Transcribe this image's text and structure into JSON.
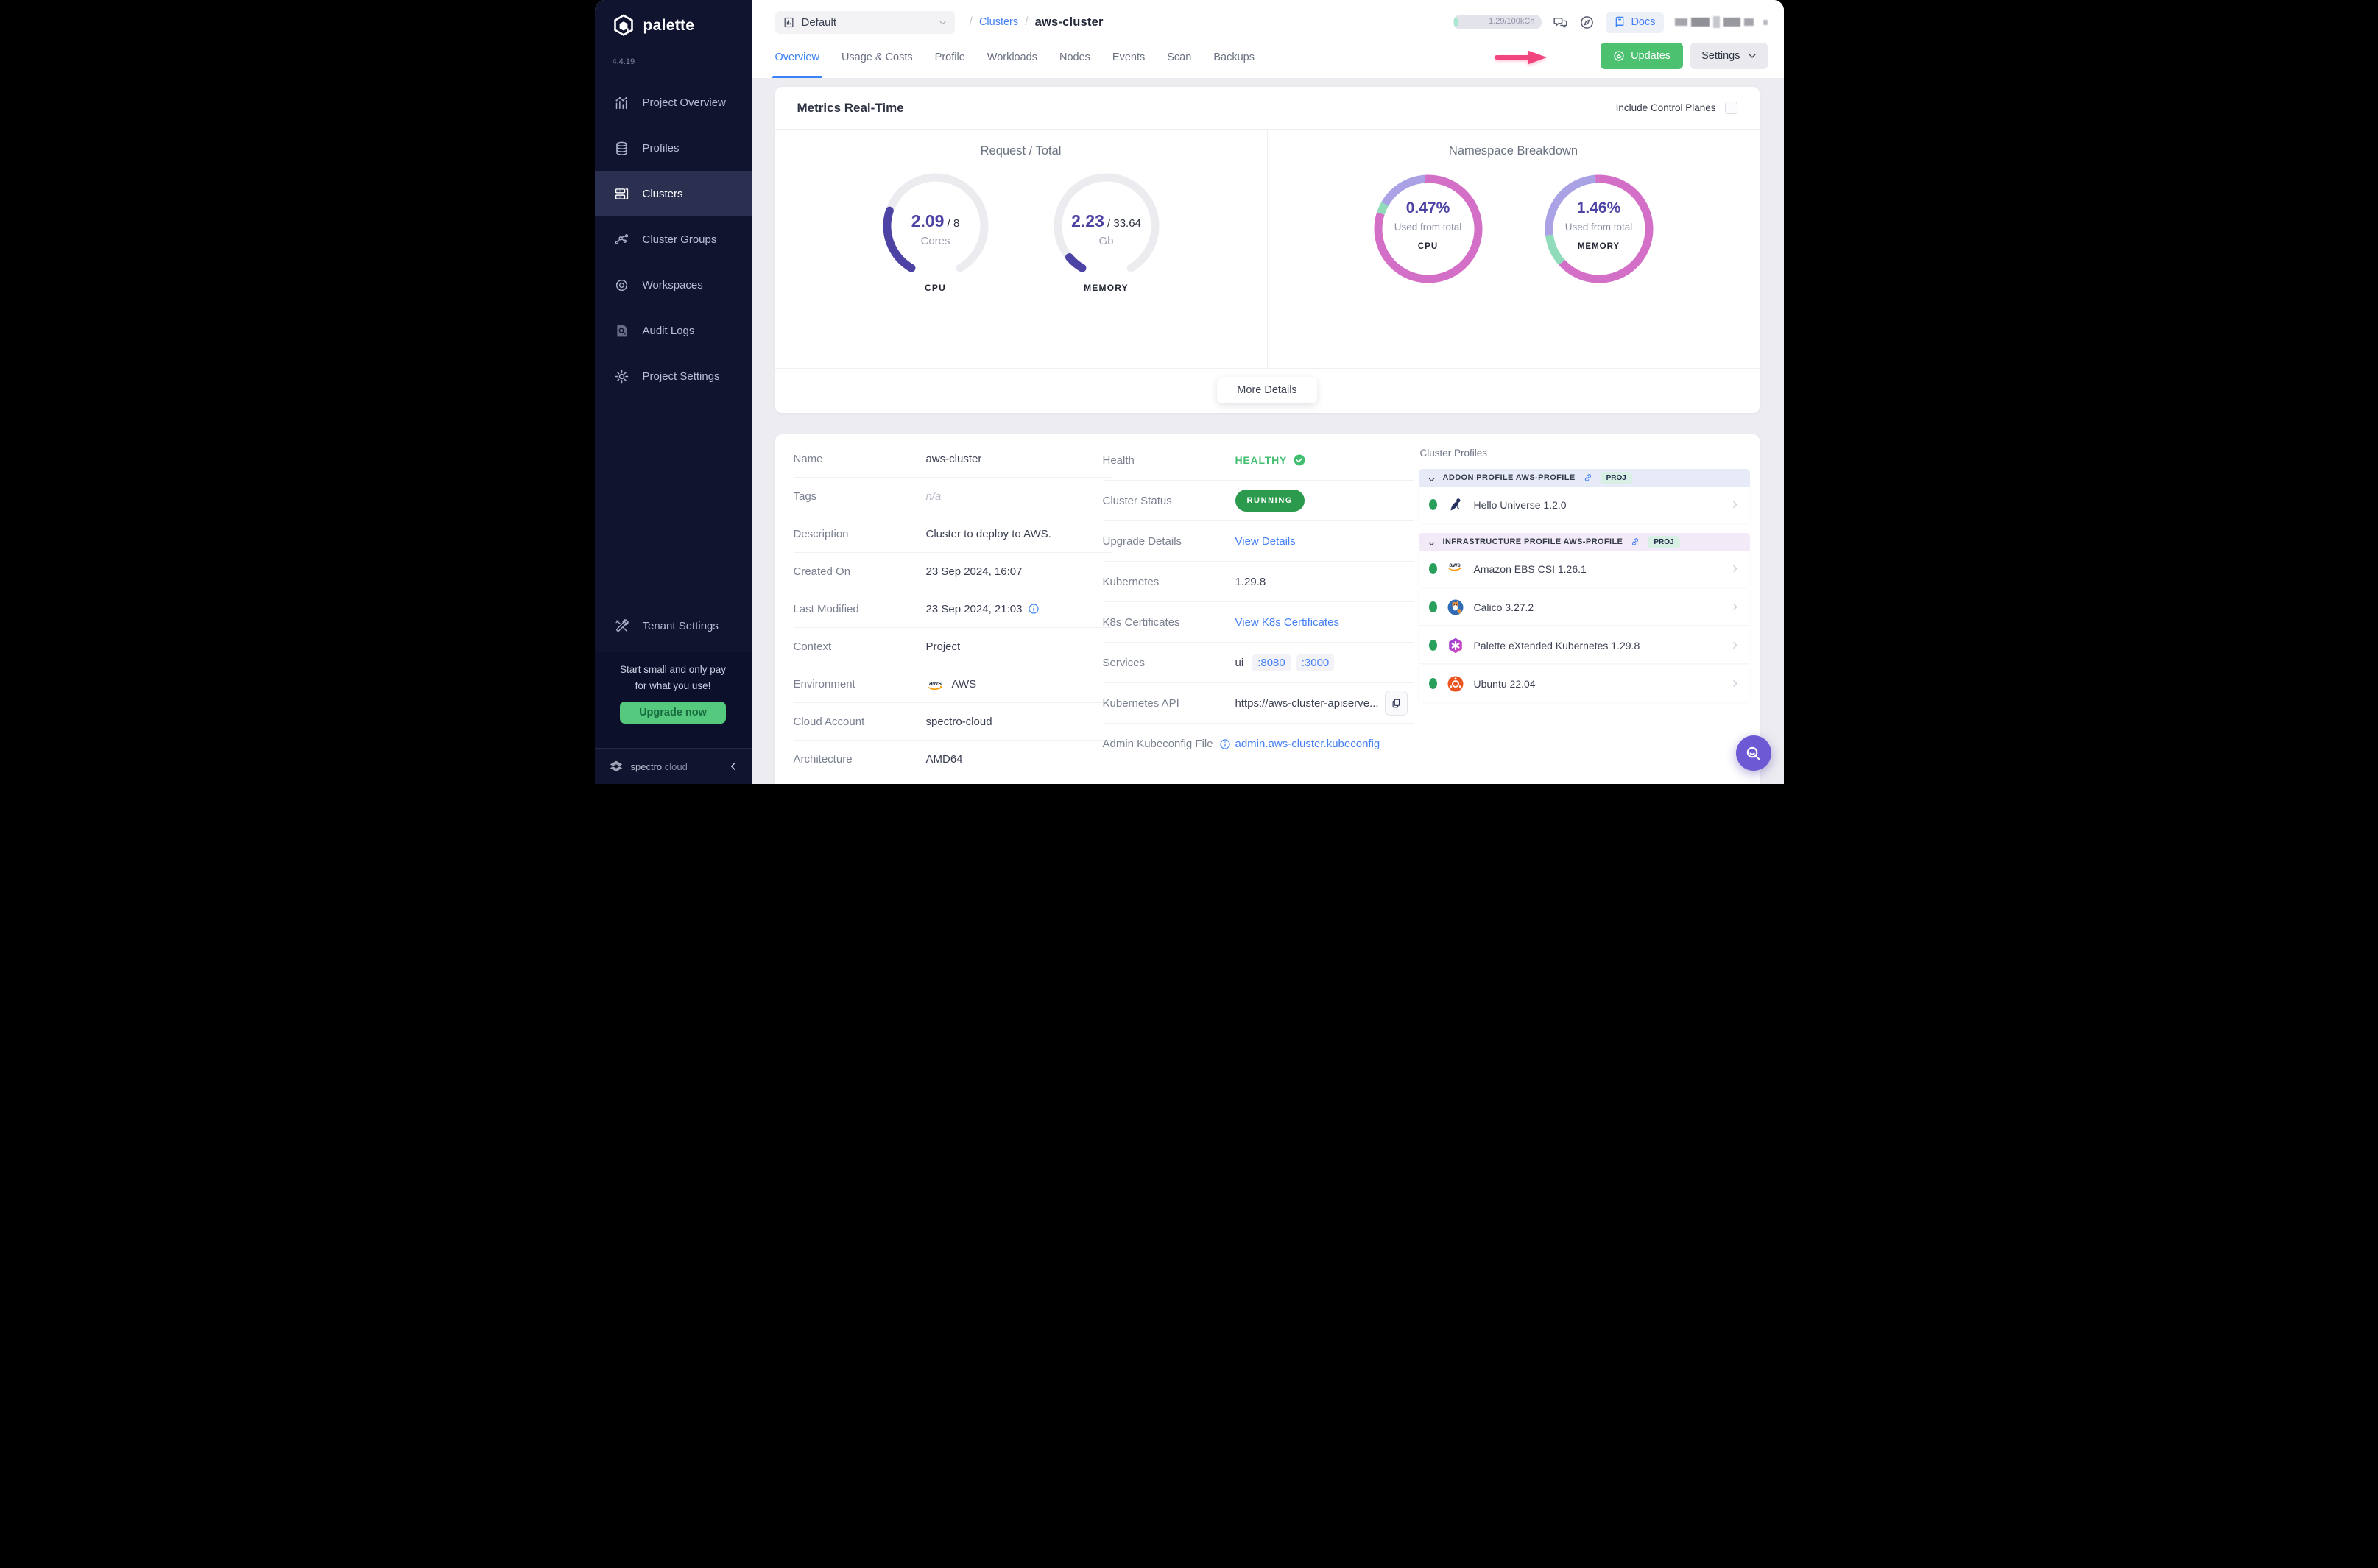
{
  "app": {
    "brand": "palette",
    "version": "4.4.19",
    "footer_brand_1": "spectro",
    "footer_brand_2": "cloud"
  },
  "sidebar": {
    "items": [
      {
        "icon": "overview-icon",
        "label": "Project Overview",
        "active": false
      },
      {
        "icon": "profiles-icon",
        "label": "Profiles",
        "active": false
      },
      {
        "icon": "clusters-icon",
        "label": "Clusters",
        "active": true
      },
      {
        "icon": "cluster-groups-icon",
        "label": "Cluster Groups",
        "active": false
      },
      {
        "icon": "workspaces-icon",
        "label": "Workspaces",
        "active": false
      },
      {
        "icon": "audit-icon",
        "label": "Audit Logs",
        "active": false
      },
      {
        "icon": "gear-icon",
        "label": "Project Settings",
        "active": false
      }
    ],
    "tenant": {
      "icon": "tools-icon",
      "label": "Tenant Settings"
    },
    "promo": {
      "line1": "Start small and only pay",
      "line2": "for what you use!",
      "cta": "Upgrade now"
    }
  },
  "topbar": {
    "project_selector": "Default",
    "breadcrumb": {
      "root_sep": "/",
      "section": "Clusters",
      "sep": "/",
      "current": "aws-cluster"
    },
    "usage_pill": "1.29/100kCh",
    "docs_label": "Docs"
  },
  "tabs": {
    "active": "Overview",
    "items": [
      "Overview",
      "Usage & Costs",
      "Profile",
      "Workloads",
      "Nodes",
      "Events",
      "Scan",
      "Backups"
    ]
  },
  "actions": {
    "updates": "Updates",
    "settings": "Settings"
  },
  "metrics": {
    "title": "Metrics Real-Time",
    "include_control_planes": "Include Control Planes",
    "include_checked": false,
    "left_title": "Request / Total",
    "right_title": "Namespace Breakdown",
    "more_details": "More Details"
  },
  "chart_data": [
    {
      "type": "gauge",
      "group": "Request / Total",
      "label": "CPU",
      "value": 2.09,
      "total": 8,
      "unit": "Cores",
      "color": "#4C43A4",
      "track": "#ECECF0"
    },
    {
      "type": "gauge",
      "group": "Request / Total",
      "label": "MEMORY",
      "value": 2.23,
      "total": 33.64,
      "unit": "Gb",
      "color": "#4C43A4",
      "track": "#ECECF0"
    },
    {
      "type": "donut",
      "group": "Namespace Breakdown",
      "label": "CPU",
      "center_value": "0.47%",
      "center_caption": "Used from total",
      "segments": [
        {
          "color": "#D36FC6",
          "from": 0,
          "to": 288
        },
        {
          "color": "#90DBB9",
          "from": 288,
          "to": 300
        },
        {
          "color": "#A9A2E5",
          "from": 300,
          "to": 356
        },
        {
          "color": "#D36FC6",
          "from": 356,
          "to": 360
        }
      ]
    },
    {
      "type": "donut",
      "group": "Namespace Breakdown",
      "label": "MEMORY",
      "center_value": "1.46%",
      "center_caption": "Used from total",
      "segments": [
        {
          "color": "#D36FC6",
          "from": 0,
          "to": 228
        },
        {
          "color": "#90DBB9",
          "from": 228,
          "to": 263
        },
        {
          "color": "#A9A2E5",
          "from": 263,
          "to": 356
        },
        {
          "color": "#D36FC6",
          "from": 356,
          "to": 360
        }
      ]
    }
  ],
  "details": {
    "left": [
      {
        "label": "Name",
        "value": "aws-cluster",
        "type": "text"
      },
      {
        "label": "Tags",
        "value": "n/a",
        "type": "muted"
      },
      {
        "label": "Description",
        "value": "Cluster to deploy to AWS.",
        "type": "text"
      },
      {
        "label": "Created On",
        "value": "23 Sep 2024, 16:07",
        "type": "text"
      },
      {
        "label": "Last Modified",
        "value": "23 Sep 2024, 21:03",
        "type": "text-info"
      },
      {
        "label": "Context",
        "value": "Project",
        "type": "text"
      },
      {
        "label": "Environment",
        "value": "AWS",
        "type": "aws"
      },
      {
        "label": "Cloud Account",
        "value": "spectro-cloud",
        "type": "text"
      },
      {
        "label": "Architecture",
        "value": "AMD64",
        "type": "text"
      }
    ],
    "middle": [
      {
        "label": "Health",
        "value": "HEALTHY",
        "type": "health"
      },
      {
        "label": "Cluster Status",
        "value": "RUNNING",
        "type": "badge"
      },
      {
        "label": "Upgrade Details",
        "value": "View Details",
        "type": "link"
      },
      {
        "label": "Kubernetes",
        "value": "1.29.8",
        "type": "text"
      },
      {
        "label": "K8s Certificates",
        "value": "View K8s Certificates",
        "type": "link"
      },
      {
        "label": "Services",
        "prefix": "ui",
        "ports": [
          ":8080",
          ":3000"
        ],
        "type": "services"
      },
      {
        "label": "Kubernetes API",
        "value": "https://aws-cluster-apiserve...",
        "type": "copy"
      },
      {
        "label": "Admin Kubeconfig File",
        "value": "admin.aws-cluster.kubeconfig",
        "type": "link",
        "label_info": true
      }
    ]
  },
  "profiles": {
    "title": "Cluster Profiles",
    "sections": [
      {
        "header": "ADDON PROFILE AWS-PROFILE",
        "badge": "PROJ",
        "theme": "addon",
        "items": [
          {
            "icon": "hello-universe-icon",
            "name": "Hello Universe 1.2.0"
          }
        ]
      },
      {
        "header": "INFRASTRUCTURE PROFILE AWS-PROFILE",
        "badge": "PROJ",
        "theme": "infra",
        "items": [
          {
            "icon": "aws-icon",
            "name": "Amazon EBS CSI 1.26.1"
          },
          {
            "icon": "calico-icon",
            "name": "Calico 3.27.2"
          },
          {
            "icon": "pxk-icon",
            "name": "Palette eXtended Kubernetes 1.29.8"
          },
          {
            "icon": "ubuntu-icon",
            "name": "Ubuntu 22.04"
          }
        ]
      }
    ]
  },
  "colors": {
    "sidebar_bg": "#10142F",
    "sidebar_active": "#2B3050",
    "accent_blue": "#4580F6",
    "tab_blue": "#3B82F6",
    "green_button": "#4CC170",
    "running_badge": "#2B9A4D",
    "healthy_green": "#43BE71",
    "status_dot": "#28A05B",
    "gauge_indigo": "#4C43A4",
    "donut_pink": "#D36FC6",
    "donut_lavender": "#A9A2E5",
    "donut_mint": "#90DBB9",
    "annotation_pink": "#F0467D",
    "fab_purple": "#6C59D3",
    "promo_green": "#55C97D"
  }
}
